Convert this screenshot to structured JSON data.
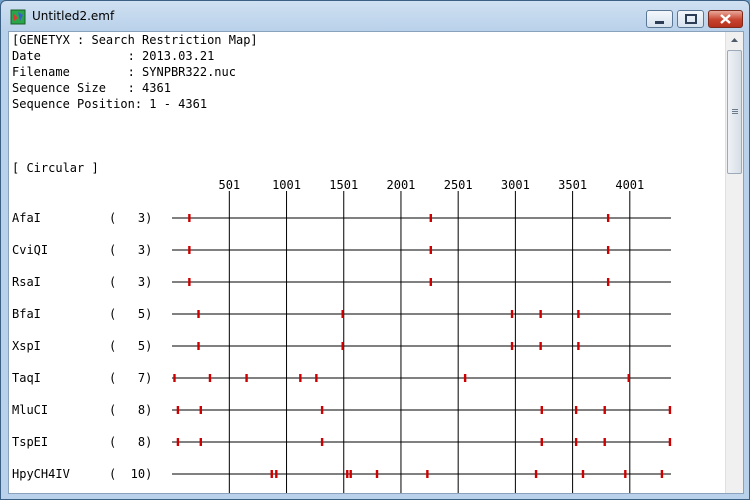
{
  "window": {
    "title": "Untitled2.emf"
  },
  "header": {
    "line0": "[GENETYX : Search Restriction Map]",
    "line1": "Date            : 2013.03.21",
    "line2": "Filename        : SYNPBR322.nuc",
    "line3": "Sequence Size   : 4361",
    "line4": "Sequence Position: 1 - 4361",
    "line5": "[ Circular ]"
  },
  "chart_data": {
    "type": "restriction-map",
    "sequence_length": 4361,
    "axis_ticks": [
      {
        "value": 501,
        "label": "501"
      },
      {
        "value": 1001,
        "label": "1001"
      },
      {
        "value": 1501,
        "label": "1501"
      },
      {
        "value": 2001,
        "label": "2001"
      },
      {
        "value": 2501,
        "label": "2501"
      },
      {
        "value": 3001,
        "label": "3001"
      },
      {
        "value": 3501,
        "label": "3501"
      },
      {
        "value": 4001,
        "label": "4001"
      }
    ],
    "enzymes": [
      {
        "name": "AfaI",
        "count": 3,
        "count_label": "(   3)",
        "sites": [
          150,
          2260,
          3810
        ]
      },
      {
        "name": "CviQI",
        "count": 3,
        "count_label": "(   3)",
        "sites": [
          150,
          2260,
          3810
        ]
      },
      {
        "name": "RsaI",
        "count": 3,
        "count_label": "(   3)",
        "sites": [
          150,
          2260,
          3810
        ]
      },
      {
        "name": "BfaI",
        "count": 5,
        "count_label": "(   5)",
        "sites": [
          230,
          1490,
          2970,
          3220,
          3550
        ]
      },
      {
        "name": "XspI",
        "count": 5,
        "count_label": "(   5)",
        "sites": [
          230,
          1490,
          2970,
          3220,
          3550
        ]
      },
      {
        "name": "TaqI",
        "count": 7,
        "count_label": "(   7)",
        "sites": [
          20,
          330,
          650,
          1120,
          1260,
          2560,
          3990
        ]
      },
      {
        "name": "MluCI",
        "count": 8,
        "count_label": "(   8)",
        "sites": [
          50,
          250,
          1310,
          3230,
          3530,
          3780,
          4350
        ]
      },
      {
        "name": "TspEI",
        "count": 8,
        "count_label": "(   8)",
        "sites": [
          50,
          250,
          1310,
          3230,
          3530,
          3780,
          4350
        ]
      },
      {
        "name": "HpyCH4IV",
        "count": 10,
        "count_label": "(  10)",
        "sites": [
          870,
          910,
          1530,
          1560,
          1790,
          2230,
          3180,
          3590,
          3960,
          4280
        ]
      }
    ],
    "colors": {
      "site": "#cc0000",
      "line": "#000000"
    }
  }
}
